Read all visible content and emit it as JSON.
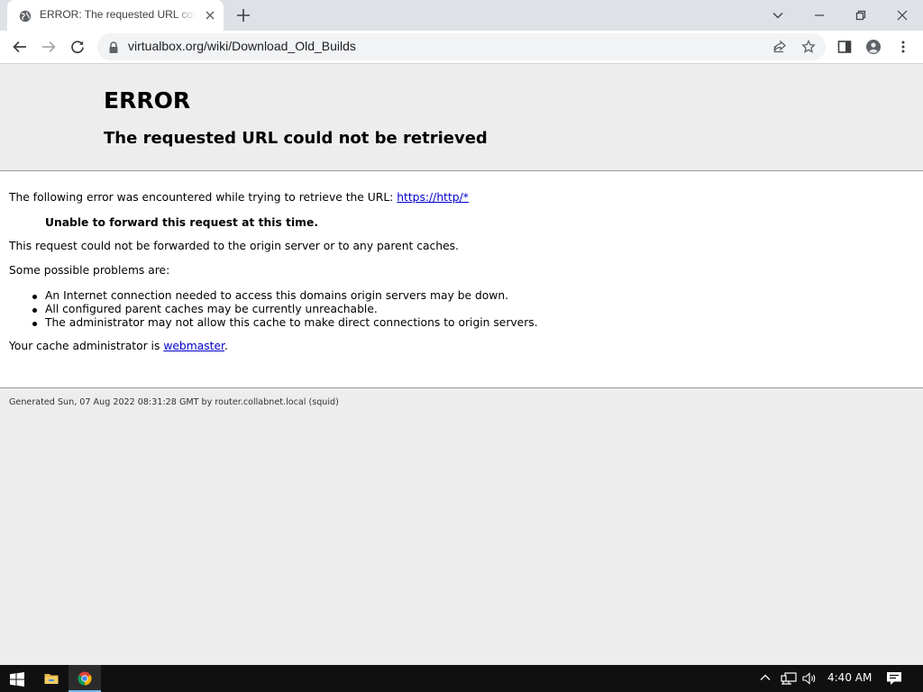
{
  "browser": {
    "tab_title": "ERROR: The requested URL could not be retrieved",
    "url": "virtualbox.org/wiki/Download_Old_Builds",
    "icons": {
      "tab_favicon": "globe-icon",
      "tab_close": "close-icon",
      "new_tab": "plus-icon",
      "tab_search": "chevron-down-icon",
      "minimize": "minimize-icon",
      "restore": "restore-icon",
      "close_window": "close-icon",
      "back": "arrow-left-icon",
      "forward": "arrow-right-icon",
      "reload": "reload-icon",
      "site_info": "lock-icon",
      "share": "share-icon",
      "bookmark": "star-icon",
      "side_panel": "side-panel-icon",
      "profile": "avatar-icon",
      "menu": "kebab-menu-icon"
    }
  },
  "page": {
    "heading": "ERROR",
    "subheading": "The requested URL could not be retrieved",
    "intro_text": "The following error was encountered while trying to retrieve the URL:",
    "intro_link": "https://http/*",
    "reason": "Unable to forward this request at this time.",
    "forward_text": "This request could not be forwarded to the origin server or to any parent caches.",
    "problems_heading": "Some possible problems are:",
    "problems": [
      "An Internet connection needed to access this domains origin servers may be down.",
      "All configured parent caches may be currently unreachable.",
      "The administrator may not allow this cache to make direct connections to origin servers."
    ],
    "admin_text": "Your cache administrator is",
    "admin_link": "webmaster",
    "admin_suffix": ".",
    "footer": "Generated Sun, 07 Aug 2022 08:31:28 GMT by router.collabnet.local (squid)"
  },
  "taskbar": {
    "clock": "4:40 AM",
    "icons": {
      "start": "windows-logo-icon",
      "explorer": "folder-icon",
      "chrome": "chrome-icon",
      "tray_up": "chevron-up-icon",
      "network": "network-icon",
      "volume": "volume-icon",
      "notifications": "notification-icon"
    }
  },
  "colors": {
    "page_background": "#ededed",
    "content_background": "#ffffff",
    "link": "#0000cc",
    "taskbar": "#101010",
    "tabstrip": "#dee1e6"
  }
}
